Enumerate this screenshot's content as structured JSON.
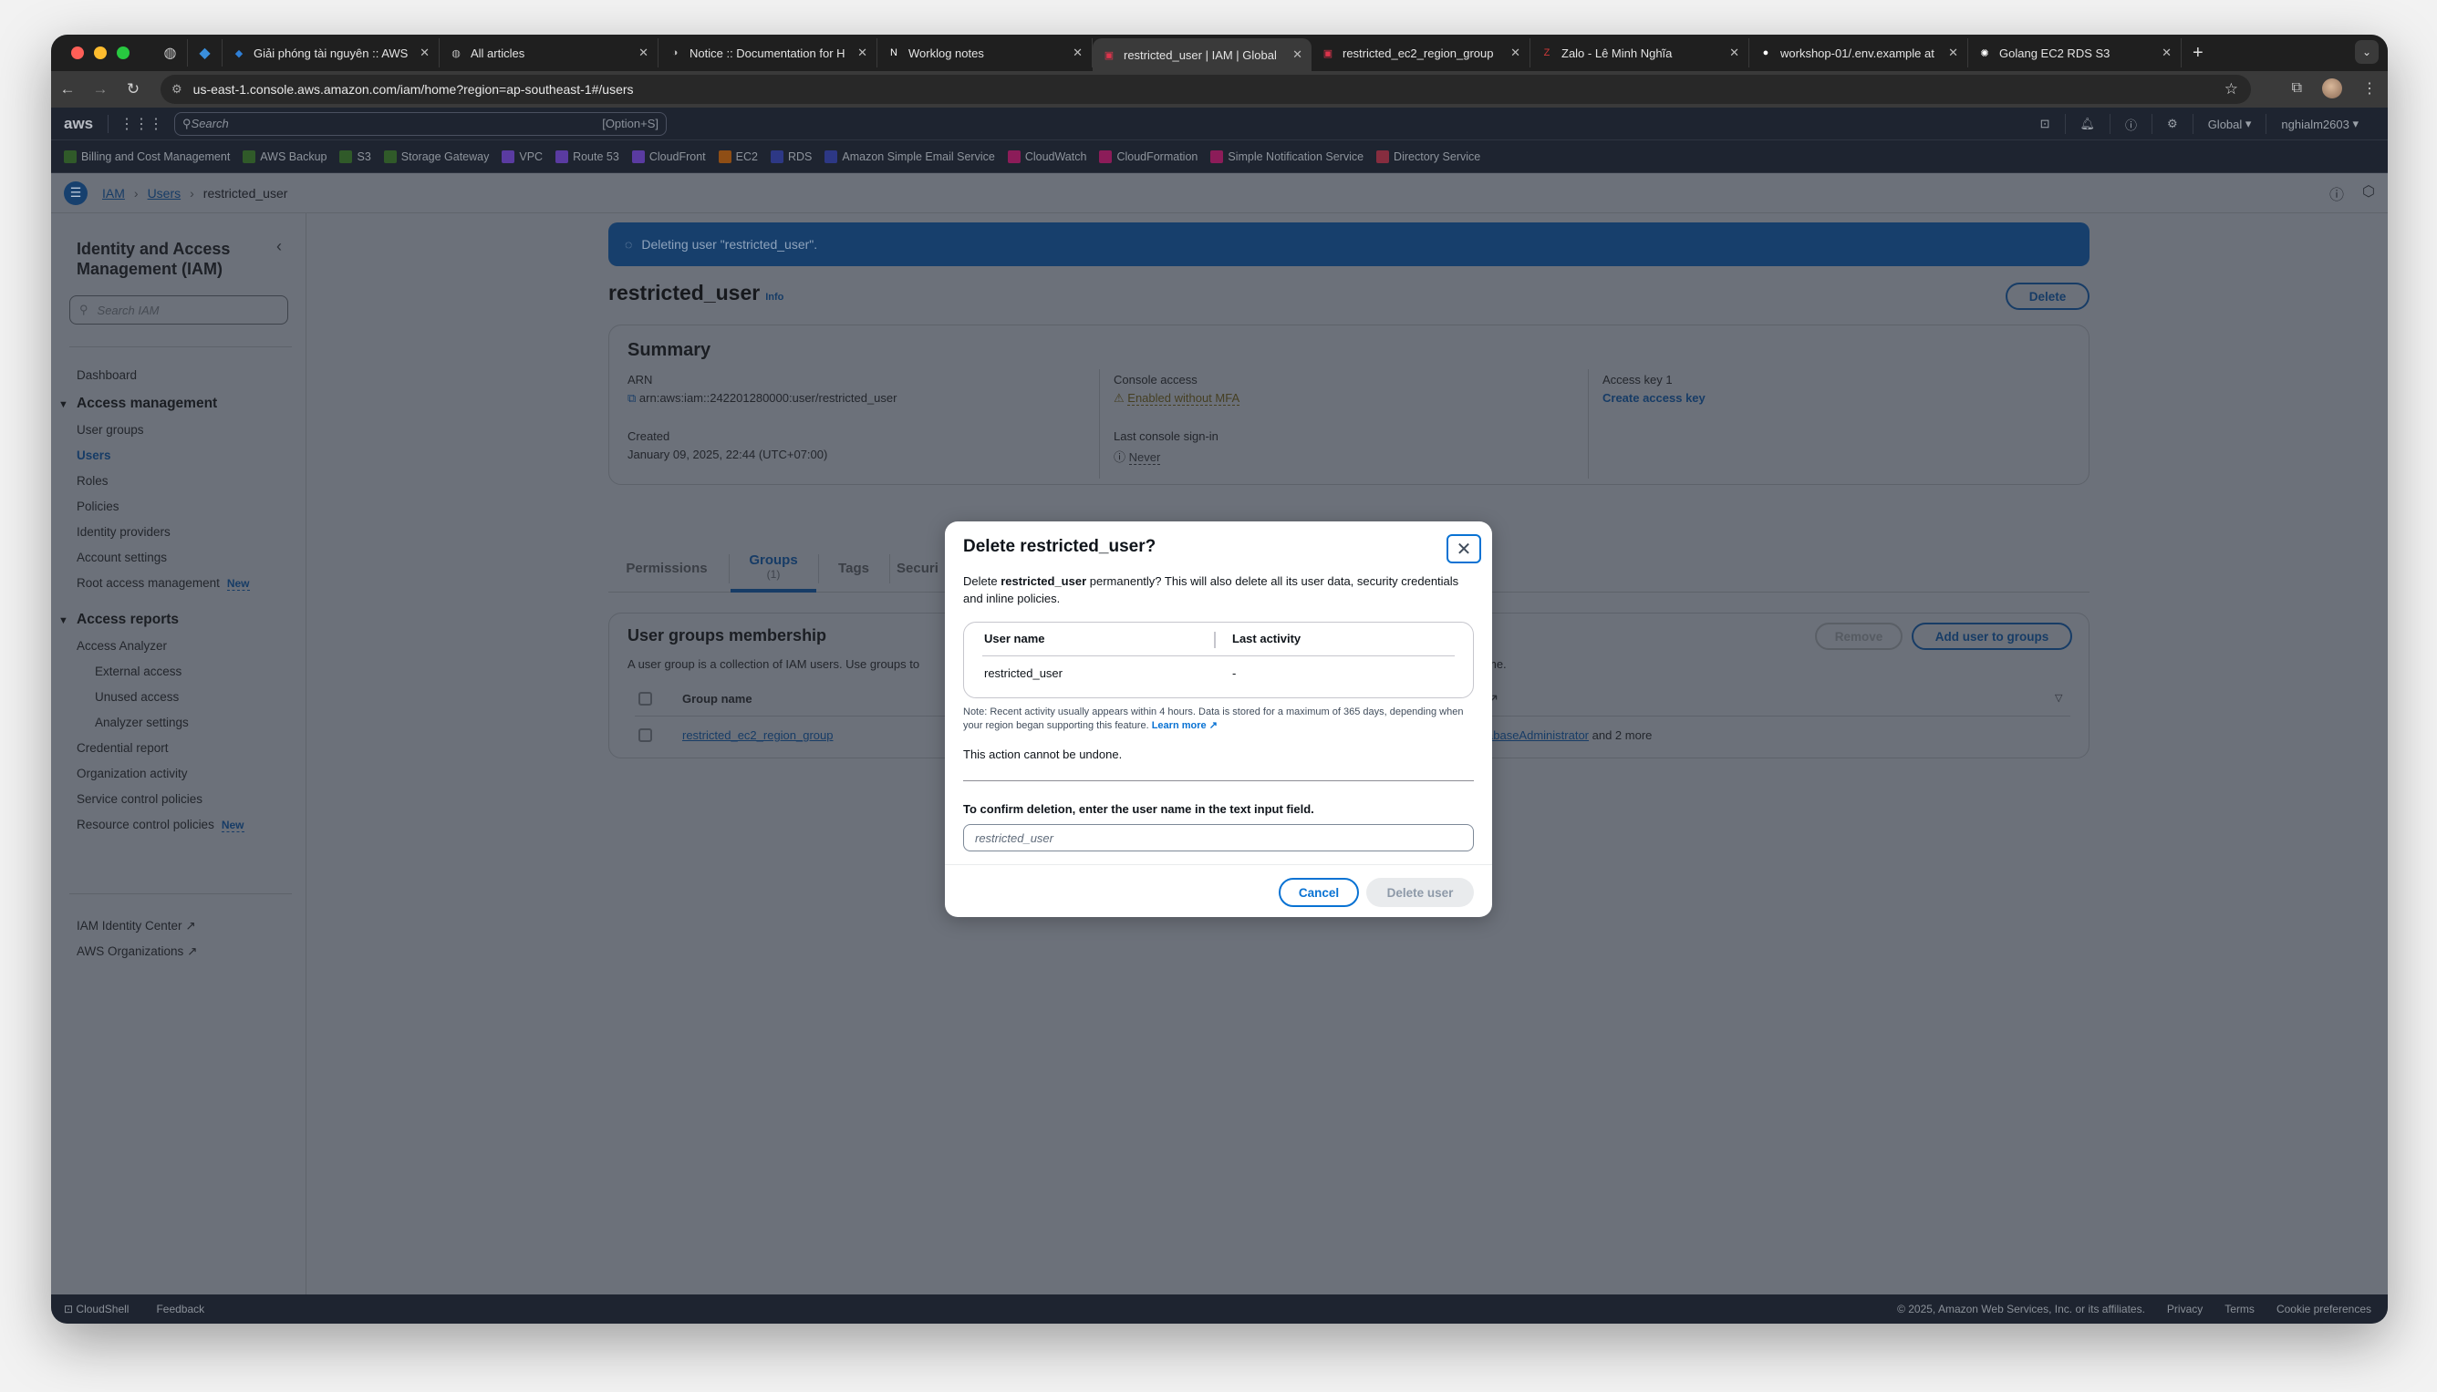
{
  "browser": {
    "tabs": [
      {
        "title": "Giải phóng tài nguyên :: AWS",
        "icon": "hugo-icon",
        "icon_color": "#2f7fd6"
      },
      {
        "title": "All articles",
        "icon": "globe-icon",
        "icon_color": "#bbbbbb"
      },
      {
        "title": "Notice :: Documentation for H",
        "icon": "docs-icon",
        "icon_color": "#bbbbbb"
      },
      {
        "title": "Worklog notes",
        "icon": "notion-icon",
        "icon_color": "#ffffff"
      },
      {
        "title": "restricted_user | IAM | Global",
        "icon": "aws-iam-icon",
        "icon_color": "#dd344c",
        "active": true
      },
      {
        "title": "restricted_ec2_region_group",
        "icon": "aws-iam-icon",
        "icon_color": "#dd344c"
      },
      {
        "title": "Zalo - Lê Minh Nghĩa",
        "icon": "zalo-icon",
        "icon_color": "#d03a3a"
      },
      {
        "title": "workshop-01/.env.example at",
        "icon": "github-icon",
        "icon_color": "#ffffff"
      },
      {
        "title": "Golang EC2 RDS S3",
        "icon": "chatgpt-icon",
        "icon_color": "#ffffff"
      }
    ],
    "url": "us-east-1.console.aws.amazon.com/iam/home?region=ap-southeast-1#/users"
  },
  "aws_nav": {
    "logo": "aws",
    "search_placeholder": "Search",
    "search_shortcut": "[Option+S]",
    "region": "Global",
    "account": "nghialm2603",
    "favorites": [
      {
        "label": "Billing and Cost Management",
        "color": "#3f8624"
      },
      {
        "label": "AWS Backup",
        "color": "#3f8624"
      },
      {
        "label": "S3",
        "color": "#3f8624"
      },
      {
        "label": "Storage Gateway",
        "color": "#3f8624"
      },
      {
        "label": "VPC",
        "color": "#8c4fff"
      },
      {
        "label": "Route 53",
        "color": "#8c4fff"
      },
      {
        "label": "CloudFront",
        "color": "#8c4fff"
      },
      {
        "label": "EC2",
        "color": "#ed7100"
      },
      {
        "label": "RDS",
        "color": "#3b48cc"
      },
      {
        "label": "Amazon Simple Email Service",
        "color": "#3b48cc"
      },
      {
        "label": "CloudWatch",
        "color": "#e7157b"
      },
      {
        "label": "CloudFormation",
        "color": "#e7157b"
      },
      {
        "label": "Simple Notification Service",
        "color": "#e7157b"
      },
      {
        "label": "Directory Service",
        "color": "#dd344c"
      }
    ]
  },
  "breadcrumb": {
    "items": [
      "IAM",
      "Users",
      "restricted_user"
    ]
  },
  "sidebar": {
    "title": "Identity and Access Management (IAM)",
    "search_placeholder": "Search IAM",
    "dashboard": "Dashboard",
    "access_management": {
      "label": "Access management",
      "items": [
        "User groups",
        "Users",
        "Roles",
        "Policies",
        "Identity providers",
        "Account settings",
        "Root access management"
      ],
      "new_badge": "New"
    },
    "access_reports": {
      "label": "Access reports",
      "items": [
        "Access Analyzer",
        "External access",
        "Unused access",
        "Analyzer settings",
        "Credential report",
        "Organization activity",
        "Service control policies",
        "Resource control policies"
      ],
      "new_badge": "New"
    },
    "external": [
      "IAM Identity Center",
      "AWS Organizations"
    ]
  },
  "main": {
    "flash": "Deleting user \"restricted_user\".",
    "title": "restricted_user",
    "info": "Info",
    "delete_label": "Delete",
    "summary": {
      "heading": "Summary",
      "arn_label": "ARN",
      "arn": "arn:aws:iam::242201280000:user/restricted_user",
      "created_label": "Created",
      "created": "January 09, 2025, 22:44 (UTC+07:00)",
      "console_access_label": "Console access",
      "console_access": "Enabled without MFA",
      "last_signin_label": "Last console sign-in",
      "last_signin": "Never",
      "access_key_label": "Access key 1",
      "create_access_key": "Create access key"
    },
    "tabs": [
      {
        "label": "Permissions"
      },
      {
        "label": "Groups",
        "count": "(1)",
        "active": true
      },
      {
        "label": "Tags"
      },
      {
        "label": "Securi"
      }
    ],
    "groups": {
      "heading": "User groups membership",
      "description": "A user group is a collection of IAM users. Use groups to",
      "description_tail": "me.",
      "remove_label": "Remove",
      "add_label": "Add user to groups",
      "column": "Group name",
      "rows": [
        {
          "name": "restricted_ec2_region_group",
          "policies_link": "abaseAdministrator",
          "policies_more": "and 2 more"
        }
      ]
    }
  },
  "modal": {
    "title": "Delete restricted_user?",
    "desc_prefix": "Delete ",
    "desc_user": "restricted_user",
    "desc_suffix": " permanently? This will also delete all its user data, security credentials and inline policies.",
    "table": {
      "headers": [
        "User name",
        "Last activity"
      ],
      "rows": [
        [
          "restricted_user",
          "-"
        ]
      ]
    },
    "note": "Note: Recent activity usually appears within 4 hours. Data is stored for a maximum of 365 days, depending when your region began supporting this feature.",
    "learn_more": "Learn more",
    "undo_warning": "This action cannot be undone.",
    "confirm_label": "To confirm deletion, enter the user name in the text input field.",
    "input_placeholder": "restricted_user",
    "input_value": "",
    "cancel_label": "Cancel",
    "delete_label": "Delete user"
  },
  "footer": {
    "cloudshell": "CloudShell",
    "feedback": "Feedback",
    "copyright": "© 2025, Amazon Web Services, Inc. or its affiliates.",
    "links": [
      "Privacy",
      "Terms",
      "Cookie preferences"
    ]
  }
}
